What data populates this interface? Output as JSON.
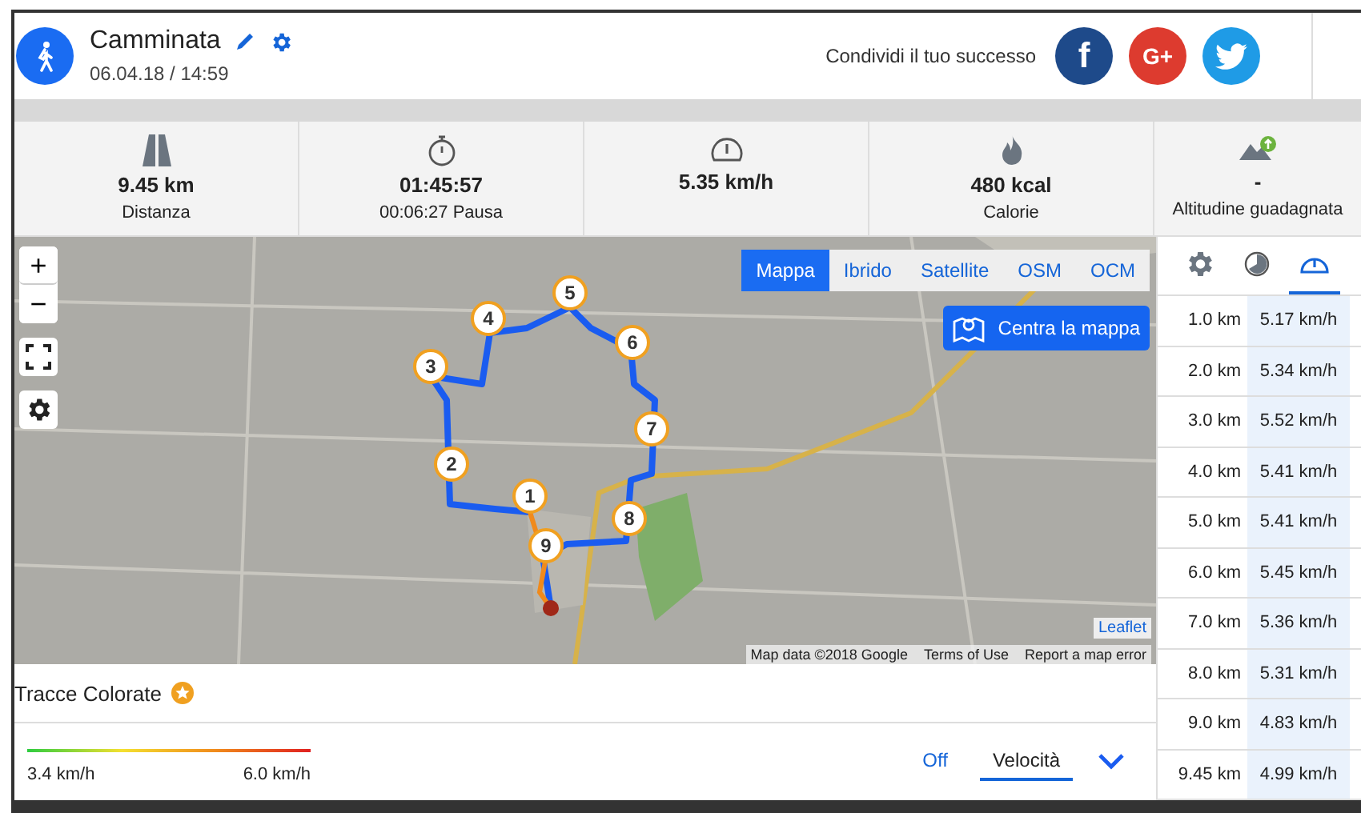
{
  "activity": {
    "title": "Camminata",
    "datetime": "06.04.18 / 14:59"
  },
  "share": {
    "label": "Condividi il tuo successo",
    "networks": [
      {
        "kind": "facebook",
        "label": "f"
      },
      {
        "kind": "googleplus",
        "label": "G+"
      },
      {
        "kind": "twitter"
      }
    ]
  },
  "stats": [
    {
      "kind": "distance",
      "value": "9.45 km",
      "label": "Distanza"
    },
    {
      "kind": "duration",
      "value": "01:45:57",
      "label": "00:06:27 Pausa"
    },
    {
      "kind": "speed",
      "value": "5.35 km/h"
    },
    {
      "kind": "calories",
      "value": "480 kcal",
      "label": "Calorie"
    },
    {
      "kind": "altitude",
      "value": "-",
      "label": "Altitudine guadagnata"
    }
  ],
  "map": {
    "zoom_controls": [
      "+",
      "−"
    ],
    "layers": [
      {
        "label": "Mappa",
        "selected": true
      },
      {
        "label": "Ibrido",
        "selected": false
      },
      {
        "label": "Satellite",
        "selected": false
      },
      {
        "label": "OSM",
        "selected": false
      },
      {
        "label": "OCM",
        "selected": false
      }
    ],
    "center_button": "Centra la mappa",
    "markers": [
      "1",
      "2",
      "3",
      "4",
      "5",
      "6",
      "7",
      "8",
      "9"
    ],
    "leaflet": "Leaflet",
    "attribution": [
      "Map data ©2018 Google",
      "Terms of Use",
      "Report a map error"
    ]
  },
  "colored_tracks": {
    "title": "Tracce Colorate",
    "min": "3.4 km/h",
    "max": "6.0 km/h",
    "options": [
      {
        "label": "Off",
        "selected": false
      },
      {
        "label": "Velocità",
        "selected": true
      }
    ]
  },
  "splits": {
    "tabs": [
      {
        "kind": "settings",
        "selected": false
      },
      {
        "kind": "time",
        "selected": false
      },
      {
        "kind": "speed",
        "selected": true
      }
    ],
    "rows": [
      {
        "distance": "1.0 km",
        "speed": "5.17 km/h"
      },
      {
        "distance": "2.0 km",
        "speed": "5.34 km/h"
      },
      {
        "distance": "3.0 km",
        "speed": "5.52 km/h"
      },
      {
        "distance": "4.0 km",
        "speed": "5.41 km/h"
      },
      {
        "distance": "5.0 km",
        "speed": "5.41 km/h"
      },
      {
        "distance": "6.0 km",
        "speed": "5.45 km/h"
      },
      {
        "distance": "7.0 km",
        "speed": "5.36 km/h"
      },
      {
        "distance": "8.0 km",
        "speed": "5.31 km/h"
      },
      {
        "distance": "9.0 km",
        "speed": "4.83 km/h"
      },
      {
        "distance": "9.45 km",
        "speed": "4.99 km/h"
      }
    ]
  }
}
